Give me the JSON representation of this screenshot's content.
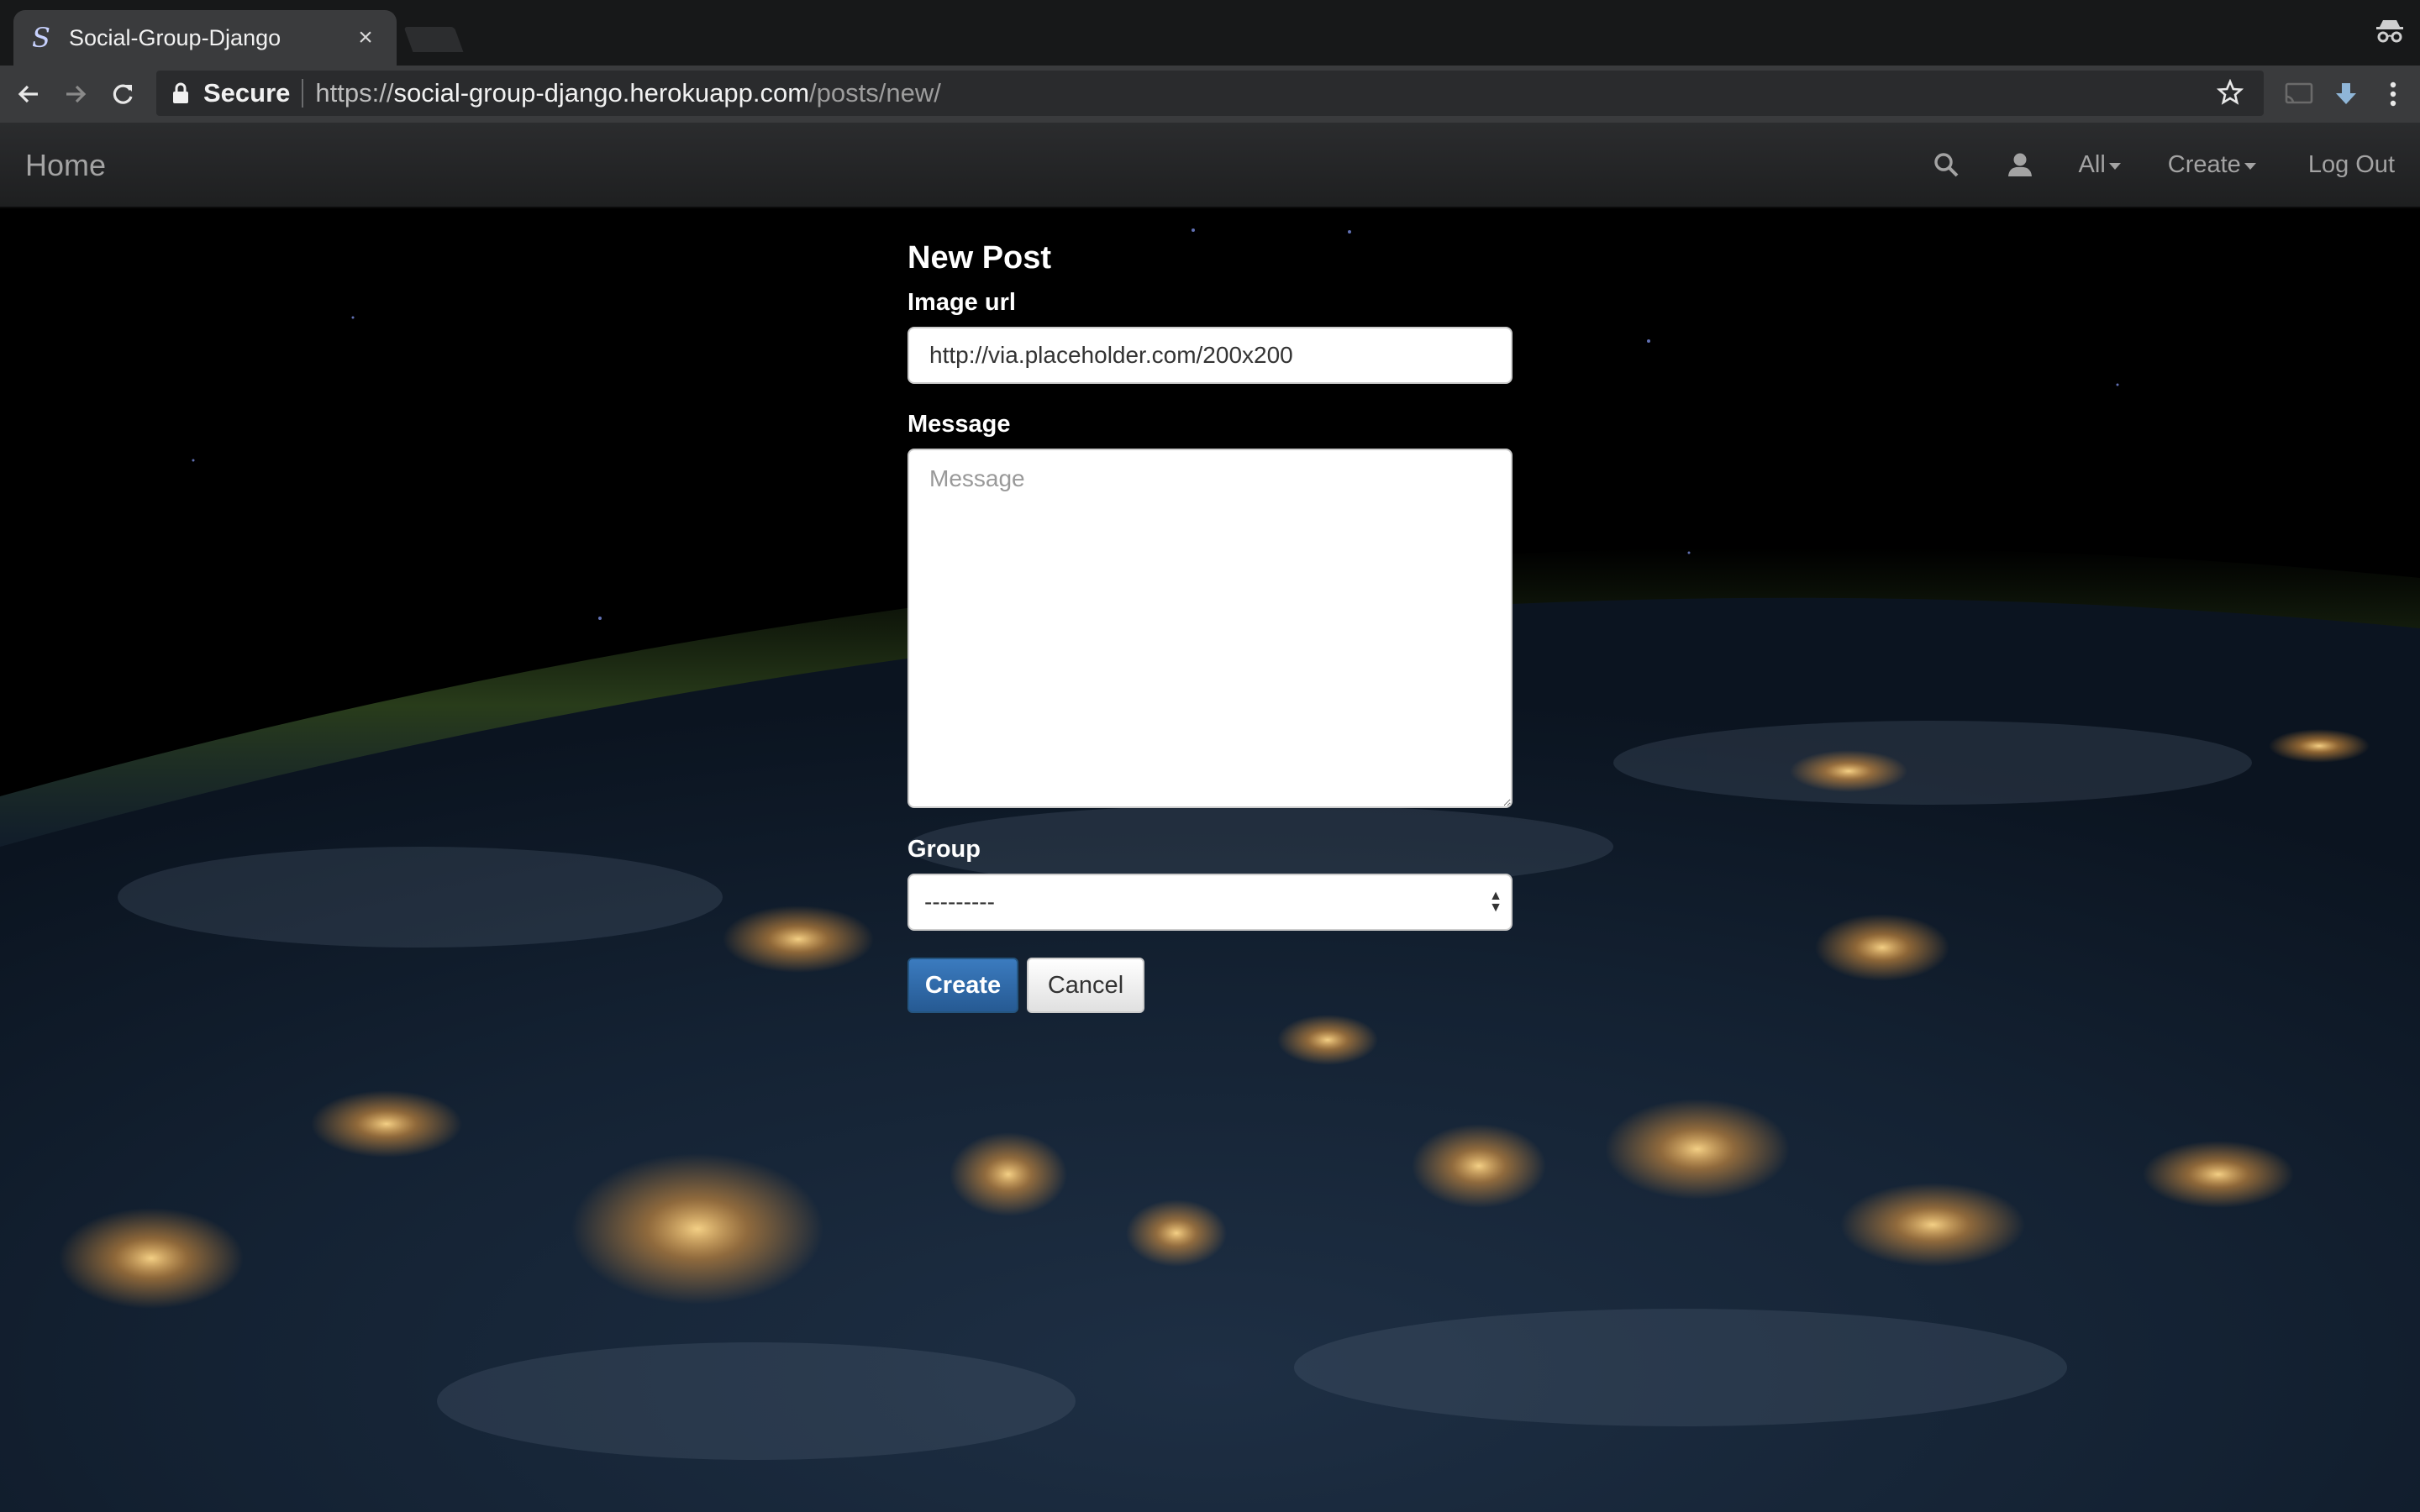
{
  "browser": {
    "tab_title": "Social-Group-Django",
    "tab_favicon": "S",
    "tab_close": "×",
    "secure_label": "Secure",
    "url_scheme": "https://",
    "url_host": "social-group-django.herokuapp.com",
    "url_path": "/posts/new/"
  },
  "navbar": {
    "brand": "Home",
    "all_label": "All",
    "create_label": "Create",
    "logout_label": "Log Out"
  },
  "form": {
    "title": "New Post",
    "image_url_label": "Image url",
    "image_url_value": "http://via.placeholder.com/200x200",
    "message_label": "Message",
    "message_placeholder": "Message",
    "group_label": "Group",
    "group_selected": "---------",
    "create_button": "Create",
    "cancel_button": "Cancel"
  },
  "colors": {
    "primary_button": "#337ab7",
    "navbar_bg": "#222222",
    "chrome_toolbar": "#3a3b3d"
  }
}
